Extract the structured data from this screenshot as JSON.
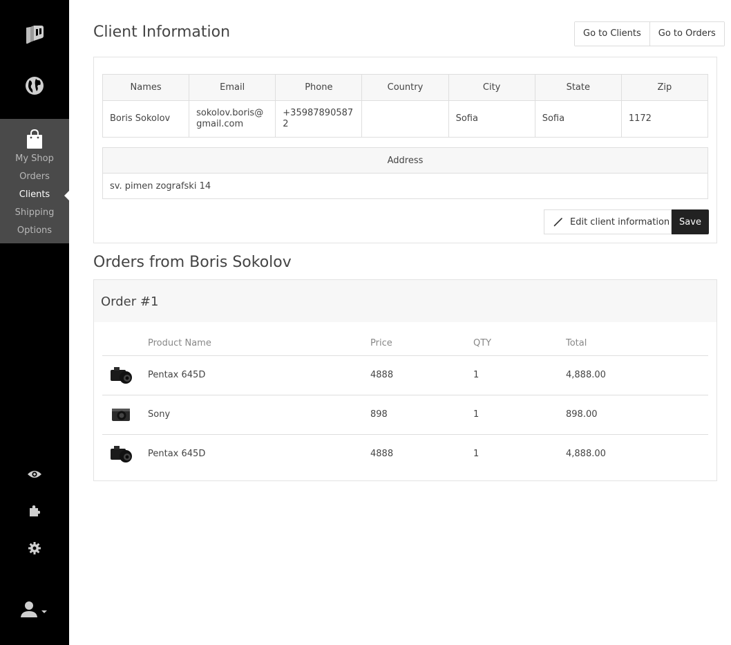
{
  "sidebar": {
    "logo_icon": "book-logo-icon",
    "globe_icon": "globe-icon",
    "shop_icon": "shopping-bag-icon",
    "items": [
      {
        "label": "My Shop",
        "active": false
      },
      {
        "label": "Orders",
        "active": false
      },
      {
        "label": "Clients",
        "active": true
      },
      {
        "label": "Shipping",
        "active": false
      },
      {
        "label": "Options",
        "active": false
      }
    ],
    "bottom_icons": [
      "eye-icon",
      "puzzle-icon",
      "gear-icon",
      "user-icon"
    ]
  },
  "header": {
    "title": "Client Information",
    "go_clients": "Go to Clients",
    "go_orders": "Go to Orders"
  },
  "client": {
    "headers": [
      "Names",
      "Email",
      "Phone",
      "Country",
      "City",
      "State",
      "Zip"
    ],
    "values": [
      "Boris Sokolov",
      "sokolov.boris@gmail.com",
      "+359878905872",
      "",
      "Sofia",
      "Sofia",
      "1172"
    ],
    "address_header": "Address",
    "address": "sv. pimen zografski 14",
    "edit_label": "Edit client information",
    "save_label": "Save"
  },
  "orders": {
    "title": "Orders from Boris Sokolov",
    "order_title": "Order #1",
    "columns": [
      "Product Name",
      "Price",
      "QTY",
      "Total"
    ],
    "rows": [
      {
        "name": "Pentax 645D",
        "price": "4888",
        "qty": "1",
        "total": "4,888.00"
      },
      {
        "name": "Sony",
        "price": "898",
        "qty": "1",
        "total": "898.00"
      },
      {
        "name": "Pentax 645D",
        "price": "4888",
        "qty": "1",
        "total": "4,888.00"
      }
    ]
  },
  "colors": {
    "sidebar_bg": "#000000",
    "sidebar_active_block": "#4a4a4a",
    "save_button": "#222222"
  }
}
